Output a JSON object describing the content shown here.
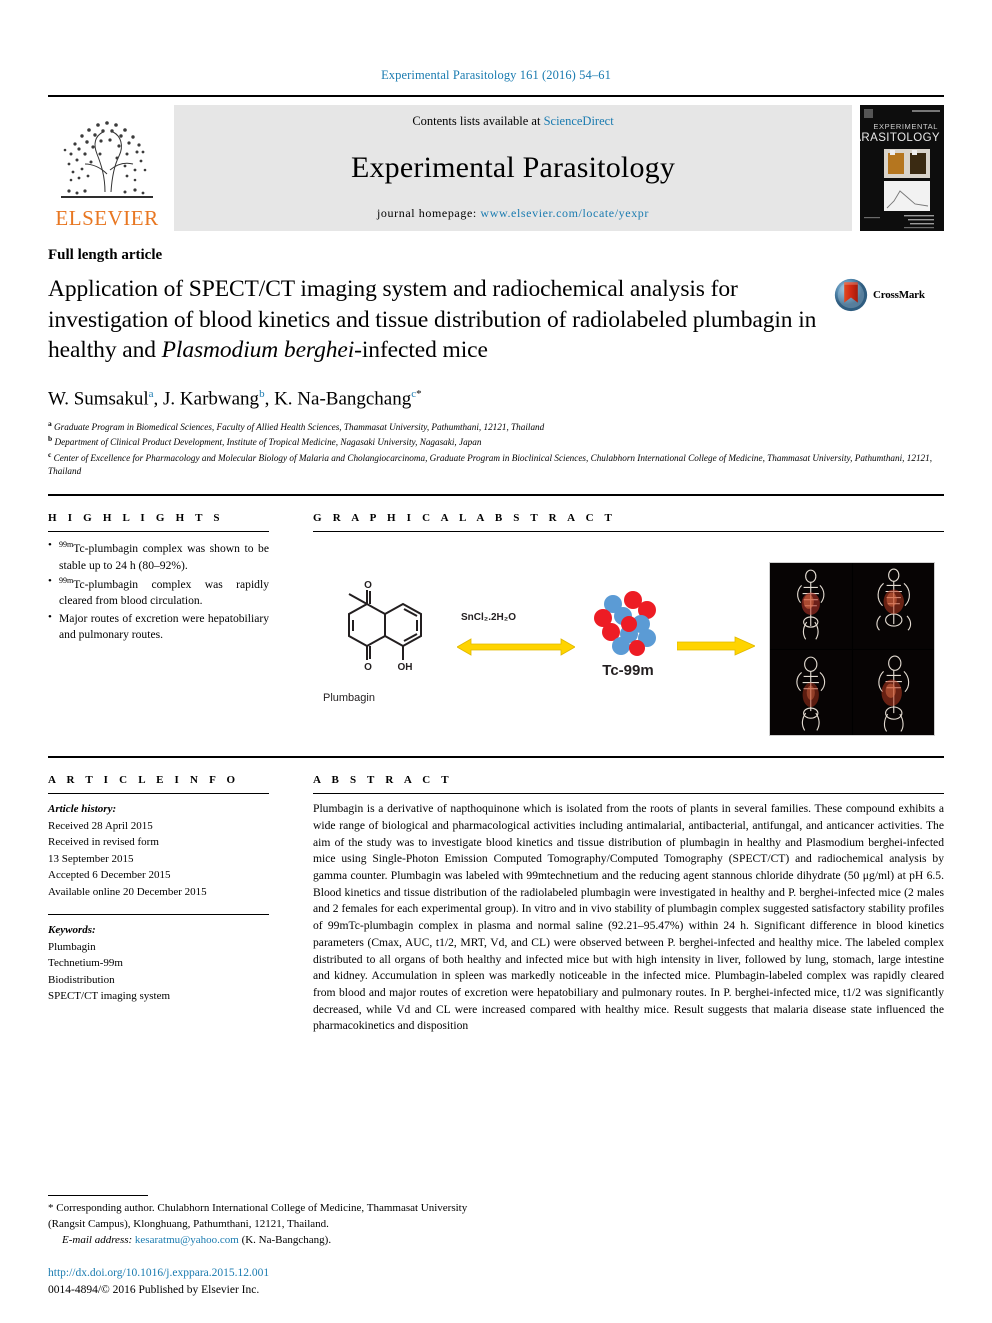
{
  "running_head": "Experimental Parasitology 161 (2016) 54–61",
  "masthead": {
    "publisher_logo_text": "ELSEVIER",
    "contents_prefix": "Contents lists available at ",
    "contents_link": "ScienceDirect",
    "journal_name": "Experimental Parasitology",
    "homepage_prefix": "journal homepage: ",
    "homepage_url": "www.elsevier.com/locate/yexpr",
    "cover": {
      "line1": "EXPERIMENTAL",
      "line2": "PARASITOLOGY"
    },
    "accent_color": "#1a7bb0",
    "elsevier_orange": "#E87722"
  },
  "article": {
    "category": "Full length article",
    "title_part1": "Application of SPECT/CT imaging system and radiochemical analysis for investigation of blood kinetics and tissue distribution of radiolabeled plumbagin in healthy and ",
    "title_italic": "Plasmodium berghei",
    "title_part2": "-infected mice",
    "crossmark_label": "CrossMark"
  },
  "authors": {
    "a1_name": "W. Sumsakul",
    "a1_sup": "a",
    "a2_name": "J. Karbwang",
    "a2_sup": "b",
    "a3_name": "K. Na-Bangchang",
    "a3_sup": "c",
    "a3_star": "*",
    "sep": ", "
  },
  "affiliations": [
    {
      "sup": "a",
      "text": "Graduate Program in Biomedical Sciences, Faculty of Allied Health Sciences, Thammasat University, Pathumthani, 12121, Thailand"
    },
    {
      "sup": "b",
      "text": "Department of Clinical Product Development, Institute of Tropical Medicine, Nagasaki University, Nagasaki, Japan"
    },
    {
      "sup": "c",
      "text": "Center of Excellence for Pharmacology and Molecular Biology of Malaria and Cholangiocarcinoma, Graduate Program in Bioclinical Sciences, Chulabhorn International College of Medicine, Thammasat University, Pathumthani, 12121, Thailand"
    }
  ],
  "highlights": {
    "heading": "H I G H L I G H T S",
    "items": [
      {
        "sup": "99m",
        "text": "Tc-plumbagin complex was shown to be stable up to 24 h (80–92%)."
      },
      {
        "sup": "99m",
        "text": "Tc-plumbagin complex was rapidly cleared from blood circulation."
      },
      {
        "sup": "",
        "text": "Major routes of excretion were hepatobiliary and pulmonary routes."
      }
    ]
  },
  "graphical_abstract": {
    "heading": "G R A P H I C A L   A B S T R A C T",
    "structure_label": "Plumbagin",
    "structure_atoms": {
      "o_top": "O",
      "o_bottom": "O",
      "oh": "OH"
    },
    "reagent_label": "SnCl₂.2H₂O",
    "isotope_label": "Tc-99m",
    "arrow_color": "#FFD400",
    "blob_blue": "#5B9BD5",
    "blob_red": "#ED1C24"
  },
  "article_info": {
    "heading": "A R T I C L E   I N F O",
    "history_label": "Article history:",
    "history": [
      "Received 28 April 2015",
      "Received in revised form",
      "13 September 2015",
      "Accepted 6 December 2015",
      "Available online 20 December 2015"
    ],
    "keywords_label": "Keywords:",
    "keywords": [
      "Plumbagin",
      "Technetium-99m",
      "Biodistribution",
      "SPECT/CT imaging system"
    ]
  },
  "abstract": {
    "heading": "A B S T R A C T",
    "paragraph": "Plumbagin is a derivative of napthoquinone which is isolated from the roots of plants in several families. These compound exhibits a wide range of biological and pharmacological activities including antimalarial, antibacterial, antifungal, and anticancer activities. The aim of the study was to investigate blood kinetics and tissue distribution of plumbagin in healthy and Plasmodium berghei-infected mice using Single-Photon Emission Computed Tomography/Computed Tomography (SPECT/CT) and radiochemical analysis by gamma counter. Plumbagin was labeled with 99mtechnetium and the reducing agent stannous chloride dihydrate (50 μg/ml) at pH 6.5. Blood kinetics and tissue distribution of the radiolabeled plumbagin were investigated in healthy and P. berghei-infected mice (2 males and 2 females for each experimental group). In vitro and in vivo stability of plumbagin complex suggested satisfactory stability profiles of 99mTc-plumbagin complex in plasma and normal saline (92.21–95.47%) within 24 h. Significant difference in blood kinetics parameters (Cmax, AUC, t1/2, MRT, Vd, and CL) were observed between P. berghei-infected and healthy mice. The labeled complex distributed to all organs of both healthy and infected mice but with high intensity in liver, followed by lung, stomach, large intestine and kidney. Accumulation in spleen was markedly noticeable in the infected mice. Plumbagin-labeled complex was rapidly cleared from blood and major routes of excretion were hepatobiliary and pulmonary routes. In P. berghei-infected mice, t1/2 was significantly decreased, while Vd and CL were increased compared with healthy mice. Result suggests that malaria disease state influenced the pharmacokinetics and disposition"
  },
  "footnote": {
    "star": "*",
    "corresponding": " Corresponding author. Chulabhorn International College of Medicine, Thammasat University (Rangsit Campus), Klonghuang, Pathumthani, 12121, Thailand.",
    "email_label": "E-mail address:",
    "email": "kesaratmu@yahoo.com",
    "email_owner": " (K. Na-Bangchang)."
  },
  "bottom": {
    "doi": "http://dx.doi.org/10.1016/j.exppara.2015.12.001",
    "copyright": "0014-4894/© 2016 Published by Elsevier Inc."
  }
}
